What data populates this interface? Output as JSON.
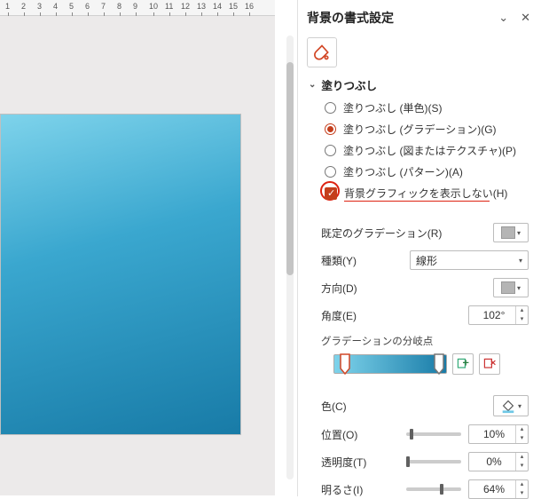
{
  "ruler": {
    "ticks": [
      1,
      2,
      3,
      4,
      5,
      6,
      7,
      8,
      9,
      10,
      11,
      12,
      13,
      14,
      15,
      16
    ]
  },
  "panel": {
    "title": "背景の書式設定",
    "section_title": "塗りつぶし",
    "fill_options": [
      {
        "label": "塗りつぶし (単色)(S)",
        "selected": false
      },
      {
        "label": "塗りつぶし (グラデーション)(G)",
        "selected": true
      },
      {
        "label": "塗りつぶし (図またはテクスチャ)(P)",
        "selected": false
      },
      {
        "label": "塗りつぶし (パターン)(A)",
        "selected": false
      }
    ],
    "hide_bg_label": "背景グラフィックを表示しない(H)",
    "hide_bg_checked": true,
    "preset_label": "既定のグラデーション(R)",
    "type_label": "種類(Y)",
    "type_value": "線形",
    "direction_label": "方向(D)",
    "angle_label": "角度(E)",
    "angle_value": "102°",
    "stops_label": "グラデーションの分岐点",
    "color_label": "色(C)",
    "position_label": "位置(O)",
    "position_value": "10%",
    "transparency_label": "透明度(T)",
    "transparency_value": "0%",
    "brightness_label": "明るさ(I)",
    "brightness_value": "64%"
  }
}
